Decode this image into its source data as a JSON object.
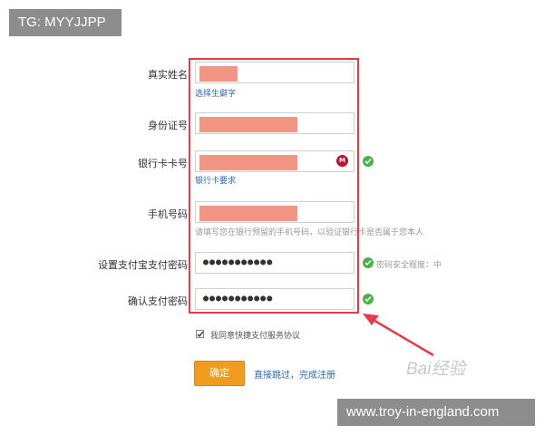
{
  "overlay": {
    "tg_badge": "TG: MYYJJPP",
    "url_badge": "www.troy-in-england.com",
    "watermark": "Bai经验"
  },
  "form": {
    "real_name": {
      "label": "真实姓名",
      "hint": "选择生僻字"
    },
    "id_number": {
      "label": "身份证号"
    },
    "bank_card": {
      "label": "银行卡卡号",
      "hint": "银行卡要求",
      "bank_icon": "bank-logo-icon"
    },
    "phone": {
      "label": "手机号码",
      "hint": "请填写您在银行预留的手机号码，以验证银行卡是否属于您本人"
    },
    "set_password": {
      "label": "设置支付宝支付密码",
      "value": "●●●●●●●●●●●",
      "strength_text": "密码安全程度：中"
    },
    "confirm_password": {
      "label": "确认支付密码",
      "value": "●●●●●●●●●●●"
    },
    "agreement": {
      "text": "我同意快捷支付服务协议",
      "checked": true
    },
    "submit_label": "确定",
    "skip_link": "直接跳过，完成注册"
  },
  "colors": {
    "highlight_frame": "#e63a4a",
    "redaction": "#f29585",
    "button": "#f29c1f",
    "link": "#2b68b3",
    "ok": "#47b34a"
  }
}
